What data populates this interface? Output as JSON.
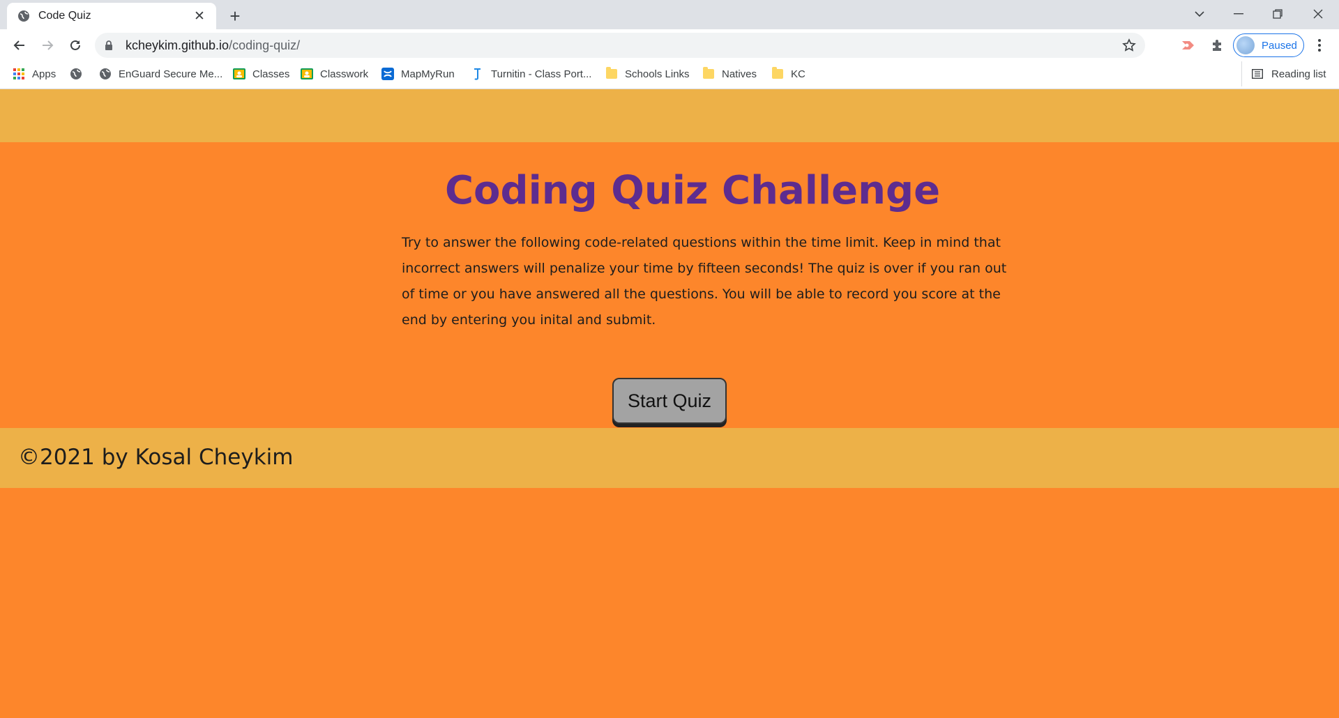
{
  "browser": {
    "tab": {
      "title": "Code Quiz",
      "close_glyph": "✕"
    },
    "new_tab_glyph": "+",
    "window_controls": {
      "tab_search": "⌄",
      "minimize": "—",
      "restore": "❐",
      "close": "✕"
    },
    "address": {
      "host": "kcheykim.github.io",
      "path": "/coding-quiz/"
    },
    "profile": {
      "label": "Paused"
    },
    "bookmarks": [
      {
        "label": "Apps",
        "icon": "apps-grid-icon"
      },
      {
        "label": "",
        "icon": "globe-icon"
      },
      {
        "label": "EnGuard Secure Me...",
        "icon": "globe-icon"
      },
      {
        "label": "Classes",
        "icon": "google-classroom-icon"
      },
      {
        "label": "Classwork",
        "icon": "google-classroom-icon"
      },
      {
        "label": "MapMyRun",
        "icon": "mapmyrun-icon"
      },
      {
        "label": "Turnitin - Class Port...",
        "icon": "turnitin-icon"
      },
      {
        "label": "Schools Links",
        "icon": "folder-icon"
      },
      {
        "label": "Natives",
        "icon": "folder-icon"
      },
      {
        "label": "KC",
        "icon": "folder-icon"
      }
    ],
    "reading_list": "Reading list"
  },
  "page": {
    "title": "Coding Quiz Challenge",
    "intro": "Try to answer the following code-related questions within the time limit. Keep in mind that incorrect answers will penalize your time by fifteen seconds! The quiz is over if you ran out of time or you have answered all the questions. You will be able to record you score at the end by entering you inital and submit.",
    "start_button": "Start Quiz",
    "footer": "©2021 by Kosal Cheykim"
  },
  "colors": {
    "background": "#fd862b",
    "band": "#edb148",
    "title": "#5d2c8f",
    "button": "#a3a3a3"
  }
}
